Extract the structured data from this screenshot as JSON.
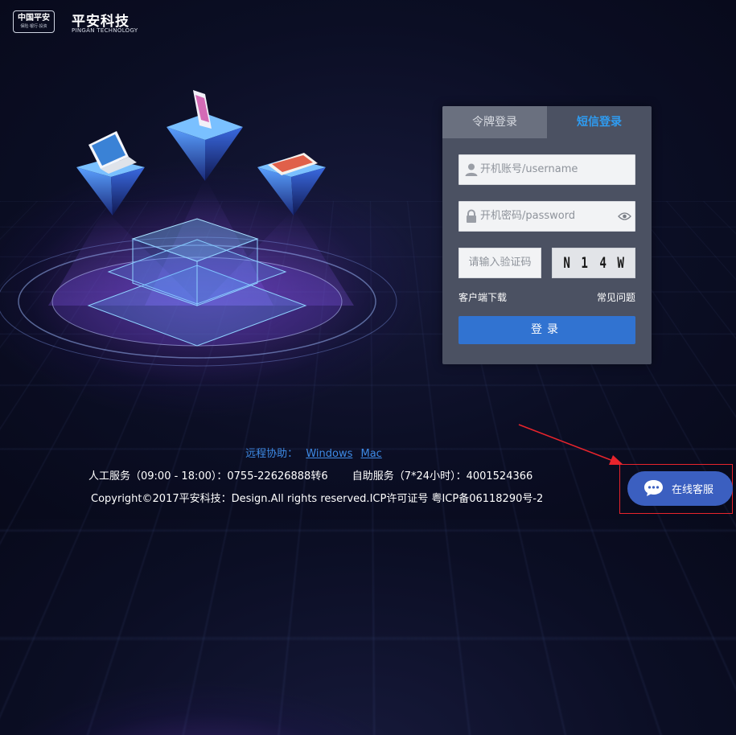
{
  "header": {
    "logo_main": "中国平安",
    "logo_sub": "保险·银行·投资",
    "brand_cn": "平安科技",
    "brand_en": "PINGAN TECHNOLOGY"
  },
  "login": {
    "tabs": [
      {
        "label": "令牌登录",
        "active": false
      },
      {
        "label": "短信登录",
        "active": true
      }
    ],
    "username_placeholder": "开机账号/username",
    "password_placeholder": "开机密码/password",
    "captcha_placeholder": "请输入验证码",
    "captcha_chars": [
      "N",
      "1",
      "4",
      "W"
    ],
    "client_download": "客户端下载",
    "faq": "常见问题",
    "submit_label": "登录"
  },
  "footer": {
    "remote_label": "远程协助：",
    "remote_windows": "Windows",
    "remote_mac": "Mac",
    "manual_service": "人工服务（09:00 - 18:00）：0755-22626888转6",
    "self_service": "自助服务（7*24小时）：4001524366",
    "copyright": "Copyright©2017平安科技：Design.All rights reserved.ICP许可证号 粤ICP备06118290号-2"
  },
  "chat": {
    "label": "在线客服"
  },
  "colors": {
    "accent_blue": "#3173d1",
    "active_tab": "#2e9cf2",
    "annotation_red": "#e8242c",
    "panel_bg": "#4b5162"
  },
  "icons": [
    "user-icon",
    "lock-icon",
    "eye-icon",
    "chat-bubble-icon"
  ]
}
